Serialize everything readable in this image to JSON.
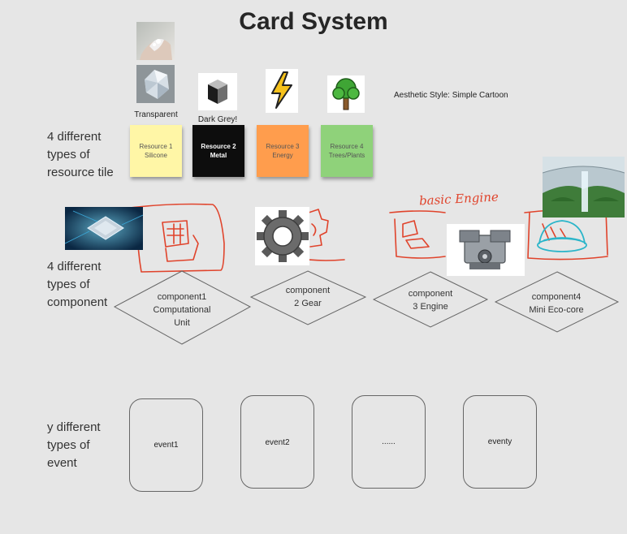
{
  "title": "Card System",
  "row_labels": {
    "resource": "4 different\ntypes of\nresource tile",
    "component": "4 different\ntypes of\ncomponent",
    "event": "y different\ntypes of\nevent"
  },
  "captions": {
    "transparent": "Transparent",
    "dark_grey": "Dark Grey!"
  },
  "aesthetic_note": "Aesthetic Style: Simple Cartoon",
  "resources": [
    {
      "label": "Resource 1\nSilicone",
      "color": "#fff6a6",
      "text_color": "#555"
    },
    {
      "label": "Resource 2\nMetal",
      "color": "#0d0d0d",
      "text_color": "#ffffff"
    },
    {
      "label": "Resource 3\nEnergy",
      "color": "#ff9d4d",
      "text_color": "#555"
    },
    {
      "label": "Resource 4\nTrees/Plants",
      "color": "#8fd27a",
      "text_color": "#555"
    }
  ],
  "components": [
    {
      "label": "component1\nComputational\nUnit"
    },
    {
      "label": "component\n2 Gear"
    },
    {
      "label": "component\n3 Engine"
    },
    {
      "label": "component4\nMini Eco-core"
    }
  ],
  "handwritten_note": "basic Engine",
  "events": [
    {
      "label": "event1"
    },
    {
      "label": "event2"
    },
    {
      "label": "......"
    },
    {
      "label": "eventy"
    }
  ],
  "colors": {
    "background": "#e6e6e6",
    "sketch_red": "#e0432b",
    "sketch_cyan": "#2bb5c9"
  }
}
